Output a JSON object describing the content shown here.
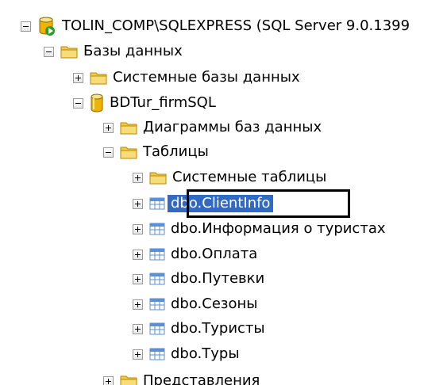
{
  "tree": {
    "server": {
      "label": "TOLIN_COMP\\SQLEXPRESS (SQL Server 9.0.1399",
      "expanded": true,
      "icon": "server-icon"
    },
    "databases": {
      "label": "Базы данных",
      "expanded": true,
      "icon": "folder-icon"
    },
    "system_databases": {
      "label": "Системные базы данных",
      "expanded": false,
      "icon": "folder-icon"
    },
    "database": {
      "label": "BDTur_firmSQL",
      "expanded": true,
      "icon": "database-icon"
    },
    "diagrams": {
      "label": "Диаграммы баз данных",
      "expanded": false,
      "icon": "folder-icon"
    },
    "tables": {
      "label": "Таблицы",
      "expanded": true,
      "icon": "folder-icon"
    },
    "system_tables": {
      "label": "Системные таблицы",
      "expanded": false,
      "icon": "folder-icon"
    },
    "table_items": [
      {
        "label": "dbo.ClientInfo",
        "selected": true,
        "icon": "table-icon"
      },
      {
        "label": "dbo.Информация о туристах",
        "selected": false,
        "icon": "table-icon"
      },
      {
        "label": "dbo.Оплата",
        "selected": false,
        "icon": "table-icon"
      },
      {
        "label": "dbo.Путевки",
        "selected": false,
        "icon": "table-icon"
      },
      {
        "label": "dbo.Сезоны",
        "selected": false,
        "icon": "table-icon"
      },
      {
        "label": "dbo.Туристы",
        "selected": false,
        "icon": "table-icon"
      },
      {
        "label": "dbo.Туры",
        "selected": false,
        "icon": "table-icon"
      }
    ],
    "views": {
      "label": "Представления",
      "expanded": false,
      "icon": "folder-icon"
    }
  },
  "colors": {
    "selection": "#316ac5",
    "folder": "#f2c94c",
    "database": "#f0b400",
    "table": "#5b8fd6",
    "server_green": "#2e9b2e"
  }
}
